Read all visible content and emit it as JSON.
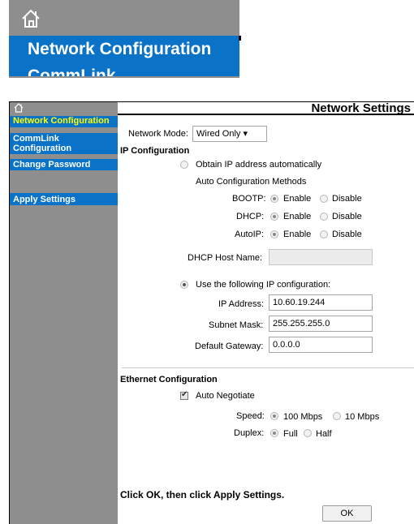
{
  "zoom": {
    "title": "Network Configuration",
    "next_label": "CommLink"
  },
  "sidebar": {
    "items": [
      {
        "label": "Network Configuration"
      },
      {
        "label": "CommLink Configuration"
      },
      {
        "label": "Change Password"
      },
      {
        "label": "Apply Settings"
      }
    ]
  },
  "header": {
    "title": "Network Settings"
  },
  "network_mode": {
    "label": "Network Mode:",
    "value": "Wired Only ▾"
  },
  "ip": {
    "section_title": "IP Configuration",
    "auto_label": "Obtain IP address automatically",
    "methods_label": "Auto Configuration Methods",
    "bootp_label": "BOOTP:",
    "dhcp_label": "DHCP:",
    "autoip_label": "AutoIP:",
    "enable": "Enable",
    "disable": "Disable",
    "dhcp_host_label": "DHCP Host Name:",
    "dhcp_host_value": "",
    "static_label": "Use the following IP configuration:",
    "address_label": "IP Address:",
    "address_value": "10.60.19.244",
    "mask_label": "Subnet Mask:",
    "mask_value": "255.255.255.0",
    "gateway_label": "Default Gateway:",
    "gateway_value": "0.0.0.0"
  },
  "ethernet": {
    "section_title": "Ethernet Configuration",
    "auto_negotiate": "Auto Negotiate",
    "speed_label": "Speed:",
    "speed_100": "100 Mbps",
    "speed_10": "10 Mbps",
    "duplex_label": "Duplex:",
    "full": "Full",
    "half": "Half"
  },
  "footer": {
    "instruction": "Click OK, then click Apply Settings.",
    "ok": "OK"
  },
  "colors": {
    "nav_blue": "#0a73c7",
    "sidebar_gray": "#8e8e8e",
    "active_text": "#ffff00"
  }
}
